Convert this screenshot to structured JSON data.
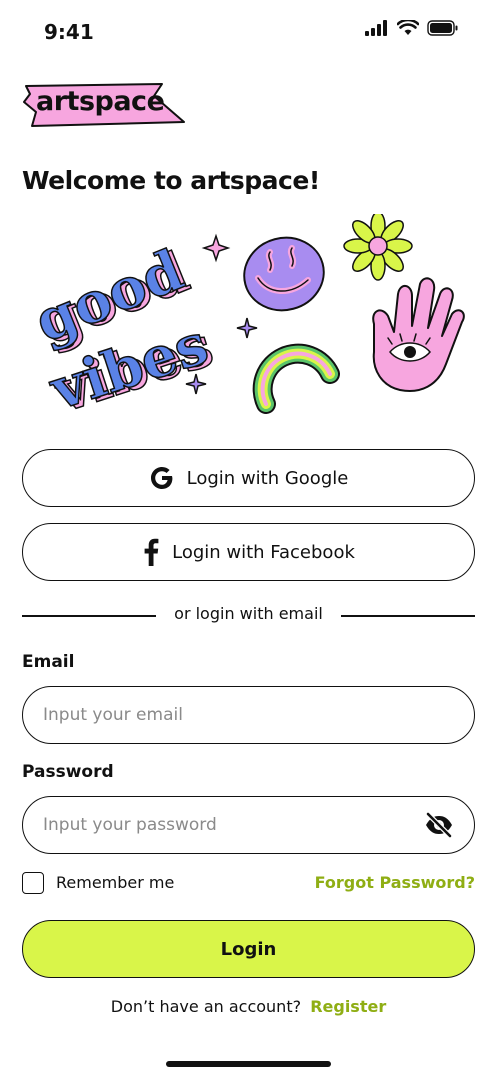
{
  "status_bar": {
    "time": "9:41"
  },
  "brand": {
    "logo_text": "artspace",
    "logo_bg": "#f7a6df"
  },
  "header": {
    "welcome": "Welcome to artspace!"
  },
  "illustration": {
    "sticker_text_1": "good",
    "sticker_text_2": "vibes"
  },
  "social": {
    "google_label": "Login with Google",
    "facebook_label": "Login with Facebook"
  },
  "divider": {
    "text": "or login with email"
  },
  "form": {
    "email_label": "Email",
    "email_placeholder": "Input your email",
    "email_value": "",
    "password_label": "Password",
    "password_placeholder": "Input your password",
    "password_value": "",
    "remember_label": "Remember me",
    "remember_checked": false,
    "forgot_label": "Forgot Password?",
    "login_label": "Login"
  },
  "footer": {
    "prompt": "Don’t have an account?",
    "register_label": "Register"
  },
  "colors": {
    "accent": "#d9f549",
    "link": "#8fae14",
    "border": "#111111"
  }
}
